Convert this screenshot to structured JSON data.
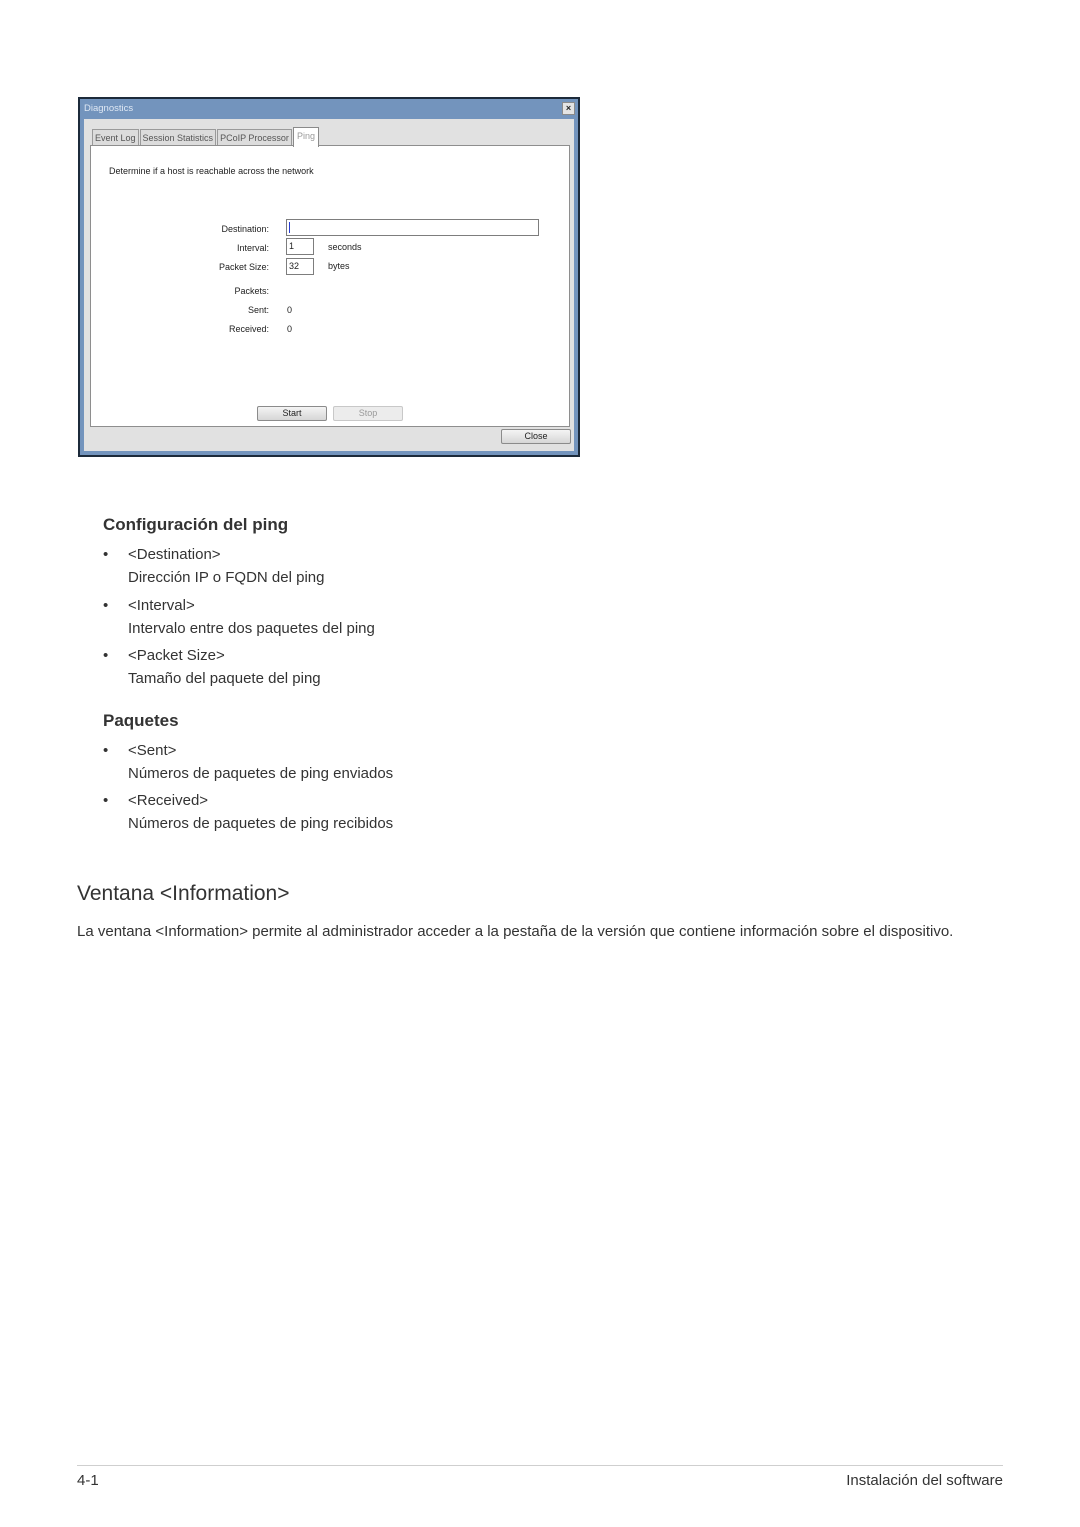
{
  "dialog": {
    "title": "Diagnostics",
    "close_glyph": "×",
    "tabs": [
      {
        "label": "Event Log",
        "active": false
      },
      {
        "label": "Session Statistics",
        "active": false
      },
      {
        "label": "PCoIP Processor",
        "active": false
      },
      {
        "label": "Ping",
        "active": true
      }
    ],
    "description": "Determine if a host is reachable across the network",
    "fields": {
      "destination": {
        "label": "Destination:",
        "value": ""
      },
      "interval": {
        "label": "Interval:",
        "value": "1",
        "unit": "seconds"
      },
      "packet_size": {
        "label": "Packet Size:",
        "value": "32",
        "unit": "bytes"
      }
    },
    "packets": {
      "label": "Packets:",
      "sent": {
        "label": "Sent:",
        "value": "0"
      },
      "received": {
        "label": "Received:",
        "value": "0"
      }
    },
    "buttons": {
      "start": "Start",
      "stop": "Stop",
      "close": "Close"
    }
  },
  "sections": [
    {
      "heading": "Configuración del ping",
      "items": [
        {
          "title": "<Destination>",
          "description": "Dirección IP o FQDN del ping"
        },
        {
          "title": "<Interval>",
          "description": "Intervalo entre dos paquetes del ping"
        },
        {
          "title": "<Packet Size>",
          "description": "Tamaño del paquete del ping"
        }
      ]
    },
    {
      "heading": "Paquetes",
      "items": [
        {
          "title": "<Sent>",
          "description": "Números de paquetes de ping enviados"
        },
        {
          "title": "<Received>",
          "description": "Números de paquetes de ping recibidos"
        }
      ]
    }
  ],
  "info_section": {
    "heading": "Ventana <Information>",
    "paragraph": "La ventana <Information> permite al administrador acceder a la pestaña de la versión que contiene información sobre el dispositivo."
  },
  "bullet_glyph": "•",
  "footer": {
    "page_number": "4-1",
    "chapter": "Instalación del software"
  }
}
